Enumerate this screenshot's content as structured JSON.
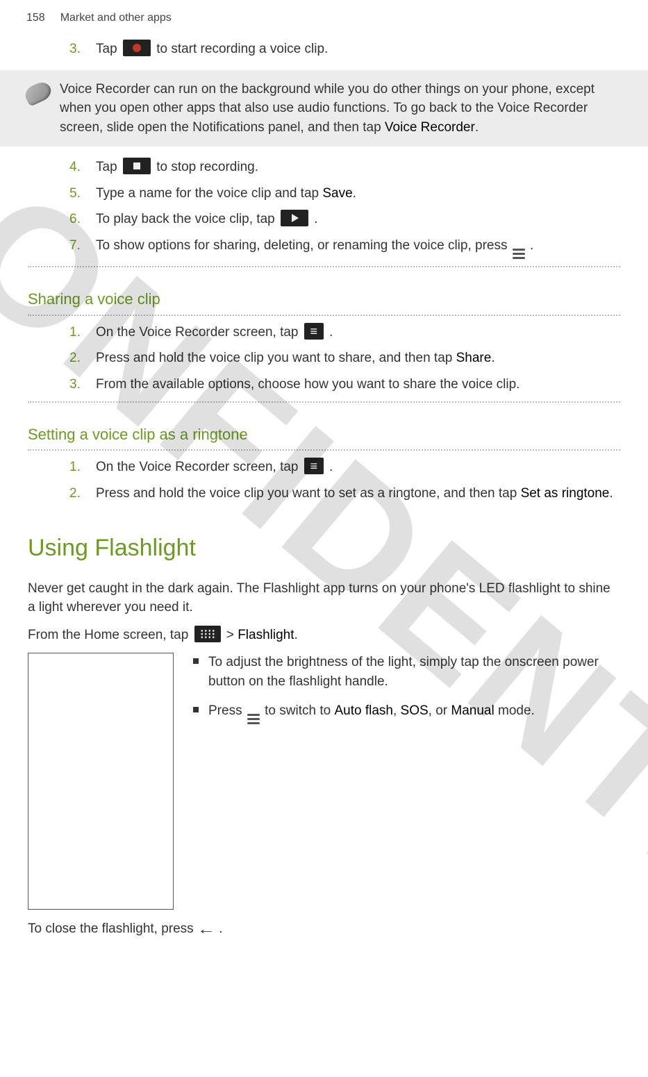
{
  "header": {
    "page_number": "158",
    "title": "Market and other apps"
  },
  "watermark": "C CONFIDENTIAL",
  "recorder": {
    "step3_a": "Tap ",
    "step3_b": " to start recording a voice clip.",
    "note_a": "Voice Recorder can run on the background while you do other things on your phone, except when you open other apps that also use audio functions. To go back to the Voice Recorder screen, slide open the Notifications panel, and then tap ",
    "note_bold": "Voice Recorder",
    "note_end": ".",
    "step4_a": "Tap ",
    "step4_b": " to stop recording.",
    "step5_a": "Type a name for the voice clip and tap ",
    "step5_bold": "Save",
    "step5_end": ".",
    "step6_a": "To play back the voice clip, tap ",
    "step6_end": ".",
    "step7_a": "To show options for sharing, deleting, or renaming the voice clip, press ",
    "step7_end": "."
  },
  "sharing": {
    "title": "Sharing a voice clip",
    "step1_a": "On the Voice Recorder screen, tap ",
    "step1_end": ".",
    "step2_a": "Press and hold the voice clip you want to share, and then tap ",
    "step2_bold": "Share",
    "step2_end": ".",
    "step3": "From the available options, choose how you want to share the voice clip."
  },
  "ringtone": {
    "title": "Setting a voice clip as a ringtone",
    "step1_a": "On the Voice Recorder screen, tap ",
    "step1_end": ".",
    "step2_a": "Press and hold the voice clip you want to set as a ringtone, and then tap ",
    "step2_bold": "Set as ringtone",
    "step2_end": "."
  },
  "flashlight": {
    "heading": "Using Flashlight",
    "intro": "Never get caught in the dark again. The Flashlight app turns on your phone's LED flashlight to shine a light wherever you need it.",
    "open_a": "From the Home screen, tap ",
    "open_sep": " > ",
    "open_bold": "Flashlight",
    "open_end": ".",
    "bullet1": "To adjust the brightness of the light, simply tap the onscreen power button on the flashlight handle.",
    "bullet2_a": "Press ",
    "bullet2_b": " to switch to ",
    "bullet2_auto": "Auto flash",
    "bullet2_sep1": ", ",
    "bullet2_sos": "SOS",
    "bullet2_sep2": ", or ",
    "bullet2_manual": "Manual",
    "bullet2_end": " mode.",
    "close_a": "To close the flashlight, press ",
    "close_end": "."
  },
  "numbers": {
    "n1": "1.",
    "n2": "2.",
    "n3": "3.",
    "n4": "4.",
    "n5": "5.",
    "n6": "6.",
    "n7": "7."
  }
}
